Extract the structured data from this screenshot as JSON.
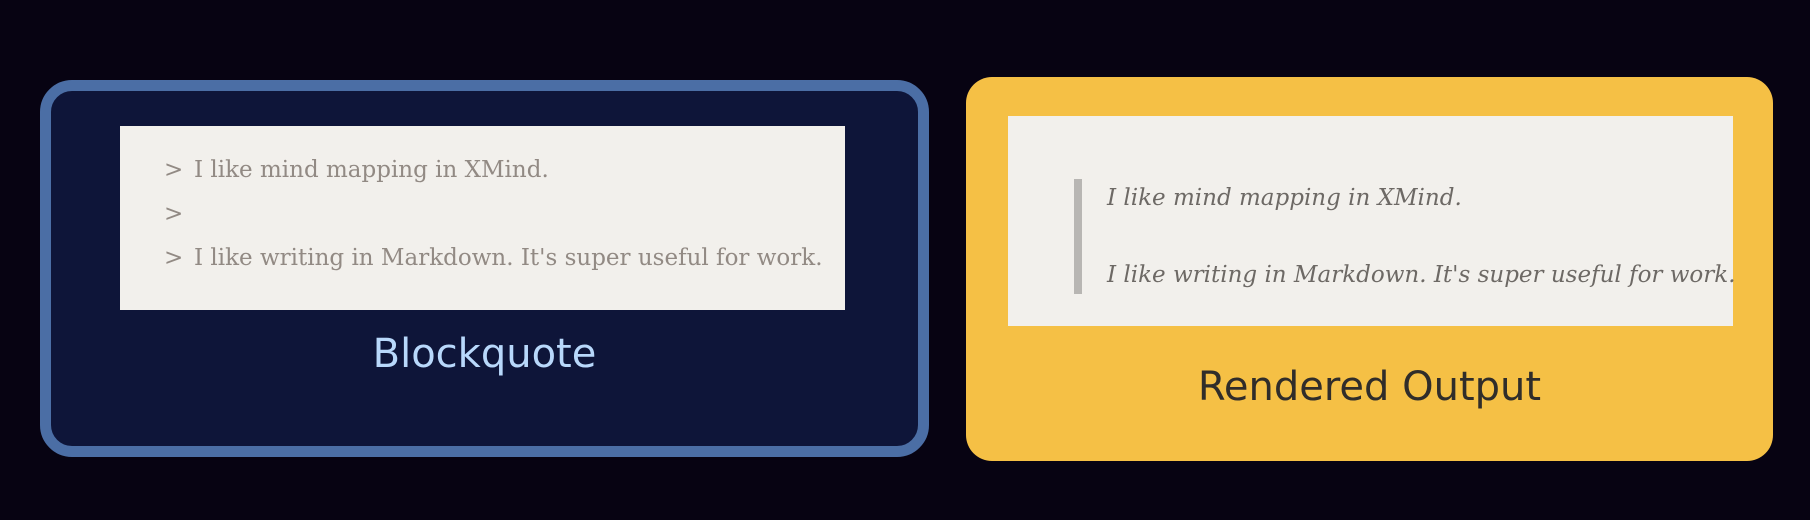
{
  "source": {
    "title": "Blockquote",
    "lines": [
      {
        "marker": ">",
        "text": "I like mind mapping in XMind."
      },
      {
        "marker": ">",
        "text": ""
      },
      {
        "marker": ">",
        "text": "I like writing in Markdown. It's super useful for work."
      }
    ]
  },
  "rendered": {
    "title": "Rendered Output",
    "paragraphs": [
      "I like mind mapping in XMind.",
      "I like writing in Markdown. It's super useful for work."
    ]
  },
  "colors": {
    "background": "#070312",
    "source_card": "#0e1539",
    "source_border": "#4b6ea5",
    "source_title": "#b8d8fb",
    "rendered_card": "#f5c045",
    "rendered_title": "#302d2a",
    "panel": "#f2f0ec",
    "quote_bar": "#b8b6b3"
  }
}
